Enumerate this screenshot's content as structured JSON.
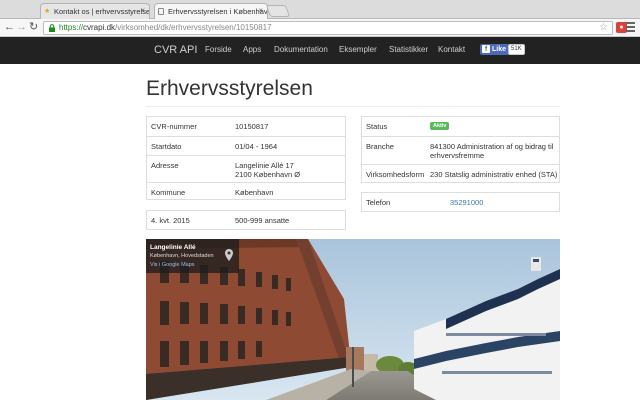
{
  "browser": {
    "tabs": [
      {
        "title": "Kontakt os | erhvervsstyrelsen",
        "active": false
      },
      {
        "title": "Erhvervsstyrelsen i København",
        "active": true
      }
    ],
    "url_scheme": "https://",
    "url_host": "cvrapi.dk",
    "url_path": "/virksomhed/dk/erhvervsstyrelsen/10150817"
  },
  "site": {
    "brand": "CVR API",
    "nav": [
      "Forside",
      "Apps",
      "Dokumentation",
      "Eksempler",
      "Statistikker",
      "Kontakt"
    ],
    "fb_like_label": "Like",
    "fb_like_count": "51K"
  },
  "company": {
    "name": "Erhvervsstyrelsen",
    "left_table": [
      {
        "key": "CVR-nummer",
        "lines": [
          "10150817"
        ]
      },
      {
        "key": "Startdato",
        "lines": [
          "01/04 - 1964"
        ]
      },
      {
        "key": "Adresse",
        "lines": [
          "Langelinie Allé 17",
          "2100 København Ø"
        ]
      },
      {
        "key": "Kommune",
        "lines": [
          "København"
        ]
      }
    ],
    "employees": {
      "key": "4. kvt. 2015",
      "value": "500-999 ansatte"
    },
    "right_table": [
      {
        "key": "Status",
        "badge": "Aktiv"
      },
      {
        "key": "Branche",
        "lines": [
          "841300 Administration af og bidrag til",
          "erhvervsfremme"
        ]
      },
      {
        "key": "Virksomhedsform",
        "lines": [
          "230 Statslig administrativ enhed (STA)"
        ]
      }
    ],
    "phone": {
      "key": "Telefon",
      "value": "35291000"
    }
  },
  "map": {
    "title": "Langelinie Allé",
    "subtitle": "København, Hovedstaden",
    "link": "Vis i Google Maps"
  },
  "colors": {
    "navbar": "#222222",
    "badge_active": "#5cb85c",
    "link": "#337ab7"
  }
}
